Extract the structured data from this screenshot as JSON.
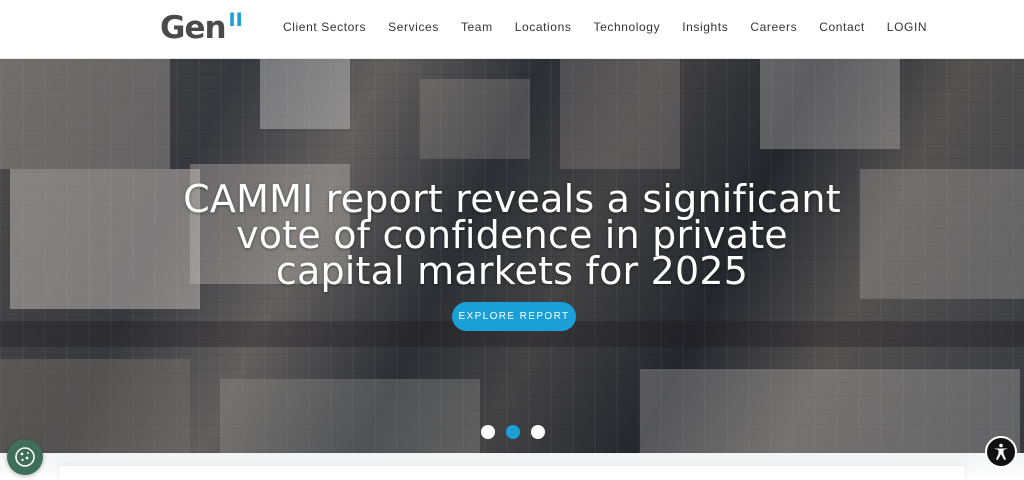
{
  "brand": {
    "logo_text": "Gen",
    "logo_accent": "II"
  },
  "nav": {
    "items": [
      {
        "label": "Client Sectors"
      },
      {
        "label": "Services"
      },
      {
        "label": "Team"
      },
      {
        "label": "Locations"
      },
      {
        "label": "Technology"
      },
      {
        "label": "Insights"
      },
      {
        "label": "Careers"
      },
      {
        "label": "Contact"
      },
      {
        "label": "LOGIN"
      }
    ]
  },
  "hero": {
    "headline": "CAMMI report reveals a significant vote of confidence in private capital markets for 2025",
    "cta_label": "EXPLORE REPORT",
    "slides": {
      "count": 3,
      "active_index": 1
    }
  },
  "widgets": {
    "cookie_icon": "cookie-icon",
    "accessibility_icon": "accessibility-icon"
  },
  "colors": {
    "accent": "#1a9fd6",
    "logo_gray": "#4a4a4a",
    "cookie_button": "#3e6e5a"
  }
}
